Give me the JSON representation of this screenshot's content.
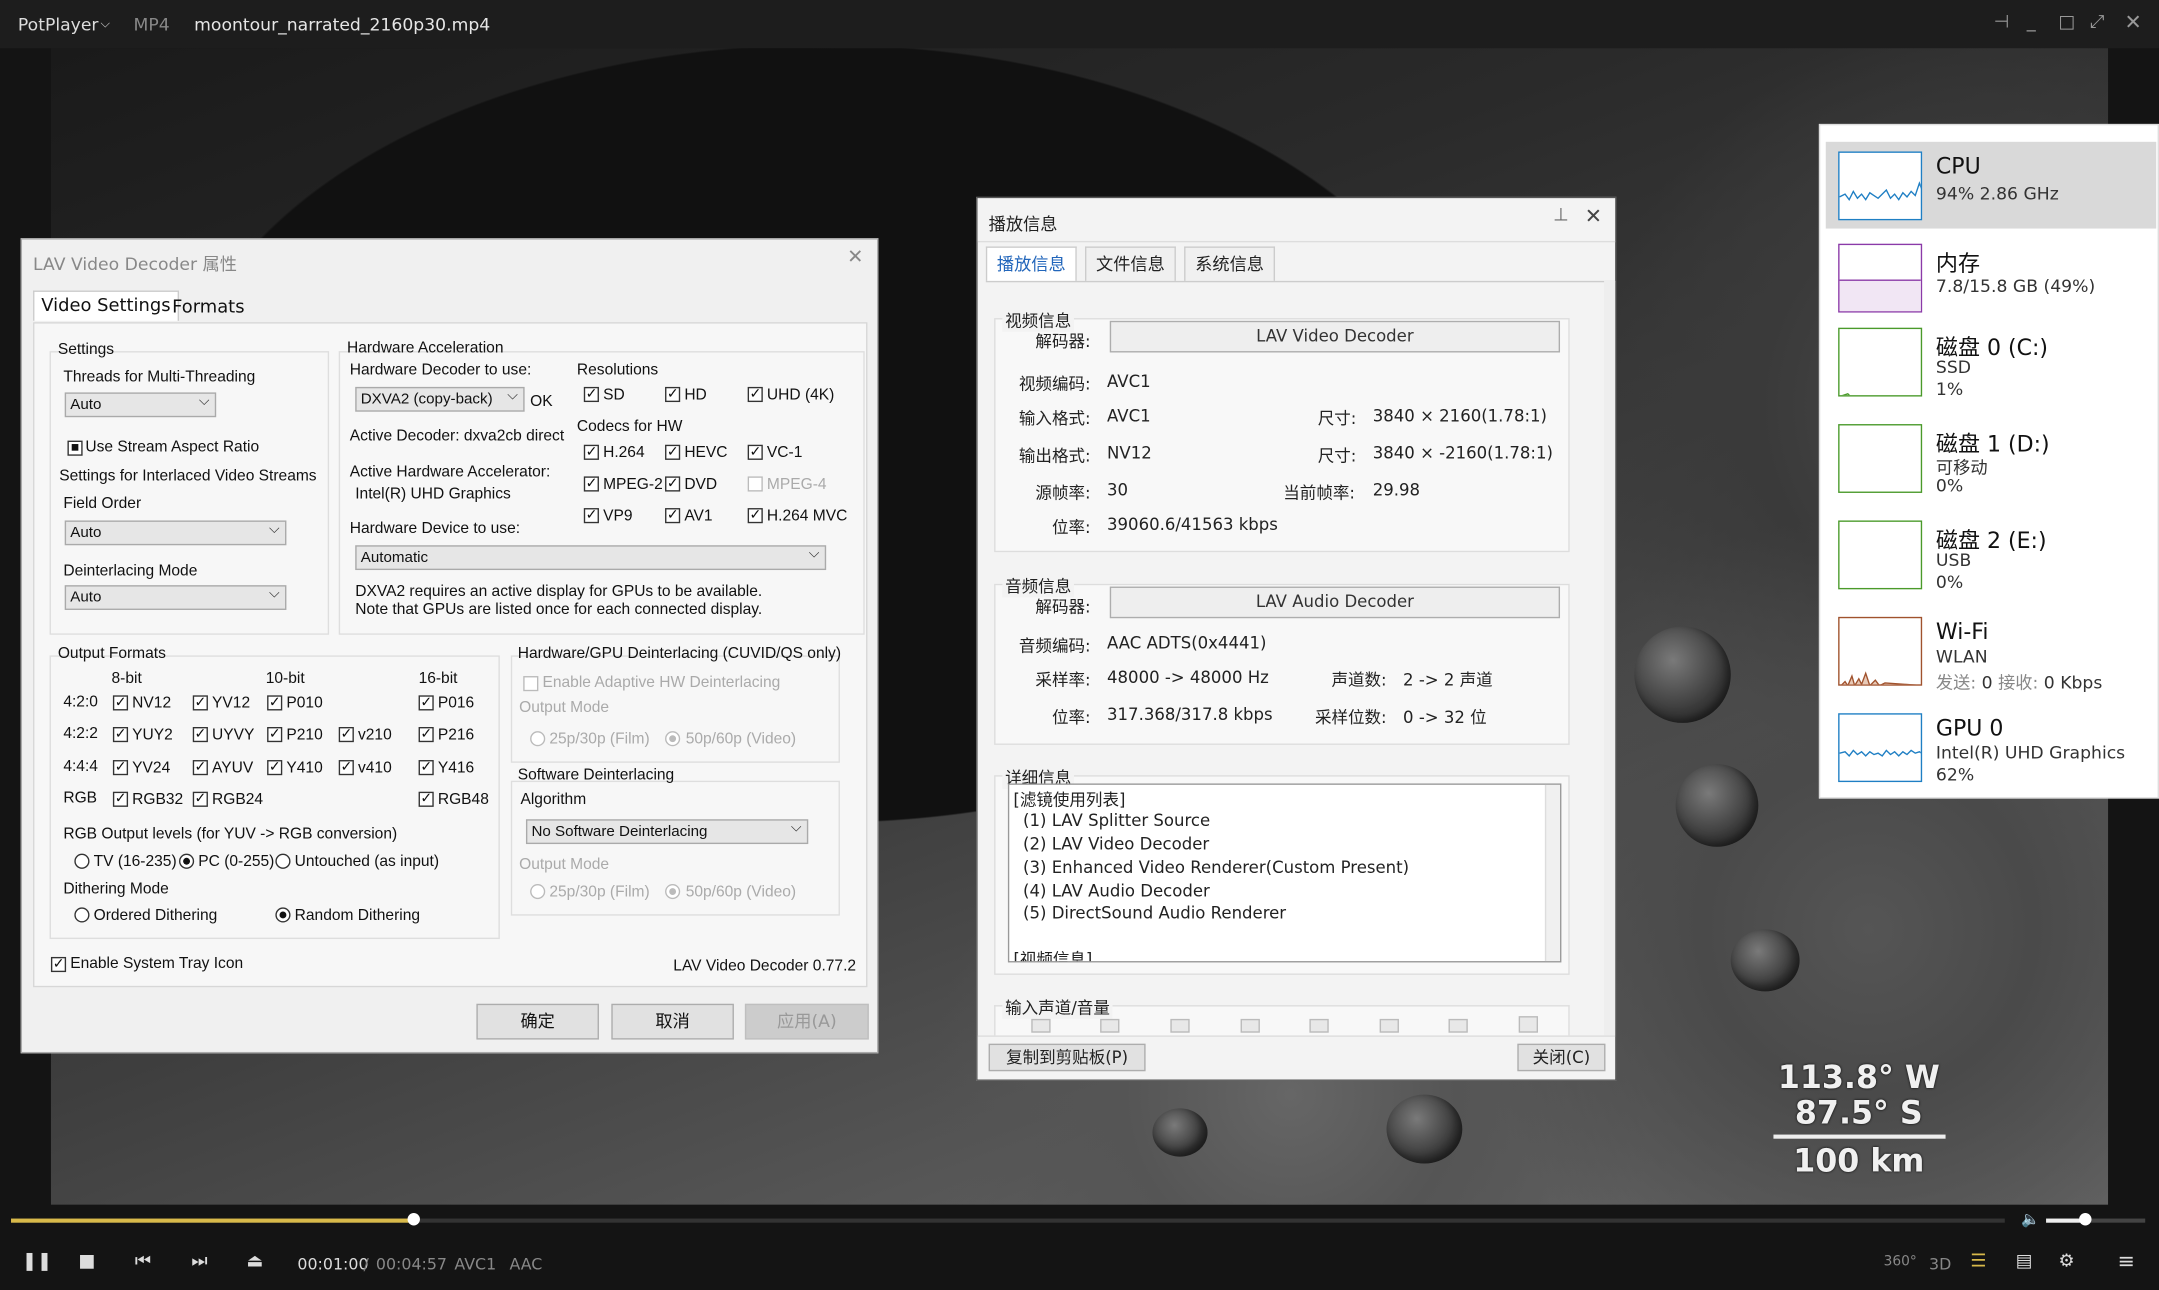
{
  "titlebar": {
    "app": "PotPlayer",
    "format": "MP4",
    "filename": "moontour_narrated_2160p30.mp4"
  },
  "overlay": {
    "coords": "113.8° W 87.5° S",
    "scale": "100 km"
  },
  "controls": {
    "elapsed": "00:01:00",
    "sep": "/",
    "total": "00:04:57",
    "vcodec": "AVC1",
    "acodec": "AAC",
    "seek_fraction": 0.202,
    "volume_fraction": 0.39,
    "btn_360": "360°",
    "btn_3d": "3D"
  },
  "lav": {
    "title": "LAV Video Decoder 属性",
    "tabs": [
      "Video Settings",
      "Formats"
    ],
    "settings": {
      "group": "Settings",
      "threads_label": "Threads for Multi-Threading",
      "threads_value": "Auto",
      "aspect": "Use Stream Aspect Ratio",
      "interlaced": "Settings for Interlaced Video Streams",
      "field_order_label": "Field Order",
      "field_order_value": "Auto",
      "deint_label": "Deinterlacing Mode",
      "deint_value": "Auto"
    },
    "hw": {
      "group": "Hardware Acceleration",
      "decoder_label": "Hardware Decoder to use:",
      "decoder_value": "DXVA2 (copy-back)",
      "ok": "OK",
      "active_decoder": "Active Decoder:  dxva2cb direct",
      "active_acc_label": "Active Hardware Accelerator:",
      "active_acc": "Intel(R) UHD Graphics",
      "resolutions": "Resolutions",
      "res": [
        "SD",
        "HD",
        "UHD (4K)"
      ],
      "codecs_label": "Codecs for HW",
      "codecs": [
        "H.264",
        "HEVC",
        "VC-1",
        "MPEG-2",
        "DVD",
        "MPEG-4",
        "VP9",
        "AV1",
        "H.264 MVC"
      ],
      "device_label": "Hardware Device to use:",
      "device_value": "Automatic",
      "note1": "DXVA2 requires an active display for GPUs to be available.",
      "note2": "Note that GPUs are listed once for each connected display."
    },
    "output": {
      "group": "Output Formats",
      "cols": [
        "8-bit",
        "10-bit",
        "16-bit"
      ],
      "rows": [
        "4:2:0",
        "4:2:2",
        "4:4:4",
        "RGB"
      ],
      "f420": [
        "NV12",
        "YV12",
        "P010",
        "P016"
      ],
      "f422": [
        "YUY2",
        "UYVY",
        "P210",
        "v210",
        "P216"
      ],
      "f444": [
        "YV24",
        "AYUV",
        "Y410",
        "v410",
        "Y416"
      ],
      "frgb": [
        "RGB32",
        "RGB24",
        "RGB48"
      ],
      "rgb_levels": "RGB Output levels (for YUV -> RGB conversion)",
      "tv": "TV (16-235)",
      "pc": "PC (0-255)",
      "untouched": "Untouched (as input)",
      "dither_label": "Dithering Mode",
      "ordered": "Ordered Dithering",
      "random": "Random Dithering"
    },
    "gpu_deint": {
      "group": "Hardware/GPU Deinterlacing (CUVID/QS only)",
      "adaptive": "Enable Adaptive HW Deinterlacing",
      "output_mode": "Output Mode",
      "film": "25p/30p (Film)",
      "video": "50p/60p (Video)"
    },
    "sw_deint": {
      "group": "Software Deinterlacing",
      "algo_label": "Algorithm",
      "algo_value": "No Software Deinterlacing",
      "output_mode": "Output Mode",
      "film": "25p/30p (Film)",
      "video": "50p/60p (Video)"
    },
    "tray": "Enable System Tray Icon",
    "version": "LAV Video Decoder 0.77.2",
    "buttons": {
      "ok": "确定",
      "cancel": "取消",
      "apply": "应用(A)"
    }
  },
  "pinfo": {
    "title": "播放信息",
    "tabs": [
      "播放信息",
      "文件信息",
      "系统信息"
    ],
    "video": {
      "section": "视频信息",
      "decoder_label": "解码器:",
      "decoder": "LAV Video Decoder",
      "codec_label": "视频编码:",
      "codec": "AVC1",
      "in_label": "输入格式:",
      "in": "AVC1",
      "size_label": "尺寸:",
      "in_size": "3840 × 2160(1.78:1)",
      "out_label": "输出格式:",
      "out": "NV12",
      "out_size": "3840 × -2160(1.78:1)",
      "fps_label": "源帧率:",
      "fps": "30",
      "cur_label": "当前帧率:",
      "cur": "29.98",
      "br_label": "位率:",
      "br": "39060.6/41563 kbps"
    },
    "audio": {
      "section": "音频信息",
      "decoder_label": "解码器:",
      "decoder": "LAV Audio Decoder",
      "codec_label": "音频编码:",
      "codec": "AAC ADTS(0x4441)",
      "sr_label": "采样率:",
      "sr": "48000 -> 48000 Hz",
      "ch_label": "声道数:",
      "ch": "2 -> 2 声道",
      "br_label": "位率:",
      "br": "317.368/317.8 kbps",
      "bits_label": "采样位数:",
      "bits": "0 -> 32 位"
    },
    "detail": {
      "section": "详细信息",
      "lines": [
        "[滤镜使用列表]",
        "(1) LAV Splitter Source",
        "(2) LAV Video Decoder",
        "(3) Enhanced Video Renderer(Custom Present)",
        "(4) LAV Audio Decoder",
        "(5) DirectSound Audio Renderer",
        "[视频信息]"
      ]
    },
    "input": {
      "section": "输入声道/音量"
    },
    "copy": "复制到剪贴板(P)",
    "close": "关闭(C)"
  },
  "taskmgr": [
    {
      "name": "CPU",
      "l1": "94% 2.86 GHz",
      "l2": "",
      "color": "#1f7fc4"
    },
    {
      "name": "内存",
      "l1": "7.8/15.8 GB (49%)",
      "l2": "",
      "color": "#8b3aa8"
    },
    {
      "name": "磁盘 0 (C:)",
      "l1": "SSD",
      "l2": "1%",
      "color": "#4a9a2a"
    },
    {
      "name": "磁盘 1 (D:)",
      "l1": "可移动",
      "l2": "0%",
      "color": "#4a9a2a"
    },
    {
      "name": "磁盘 2 (E:)",
      "l1": "USB",
      "l2": "0%",
      "color": "#4a9a2a"
    },
    {
      "name": "Wi-Fi",
      "l1": "WLAN",
      "l2_label_send": "发送:",
      "l2_send": "0",
      "l2_label_recv": "接收:",
      "l2_recv": "0 Kbps",
      "color": "#a0522d"
    },
    {
      "name": "GPU 0",
      "l1": "Intel(R) UHD Graphics",
      "l2": "62%",
      "color": "#1f7fc4"
    }
  ]
}
